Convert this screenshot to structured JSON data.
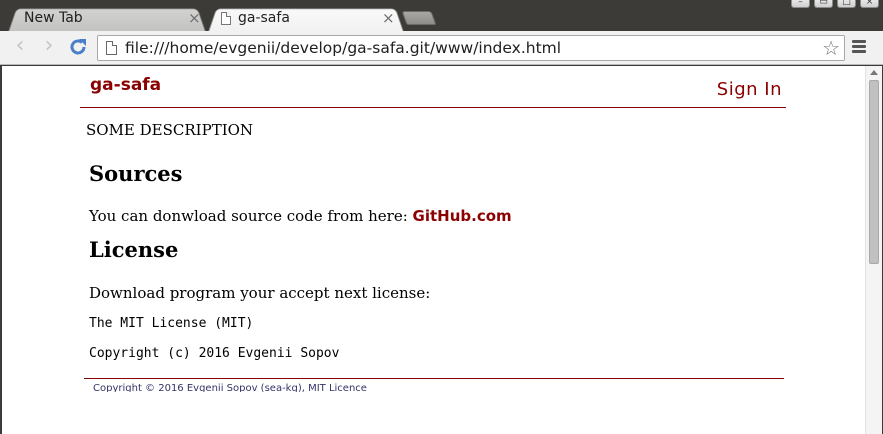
{
  "browser": {
    "tabs": [
      {
        "label": "New Tab",
        "active": false
      },
      {
        "label": "ga-safa",
        "active": true
      }
    ],
    "url": "file:///home/evgenii/develop/ga-safa.git/www/index.html"
  },
  "site": {
    "brand": "ga-safa",
    "sign_in": "Sign In",
    "description": "SOME DESCRIPTION",
    "sources_heading": "Sources",
    "sources_text": "You can donwload source code from here: ",
    "sources_link": "GitHub.com",
    "license_heading": "License",
    "license_text": "Download program your accept next license:",
    "license_name": "The MIT License (MIT)",
    "copyright": "Copyright (c) 2016 Evgenii Sopov",
    "footer": "Copyright © 2016 Evgenii Sopov (sea-kg), MIT Licence"
  },
  "colors": {
    "accent": "#8b0000",
    "chrome_dark": "#3c3b37"
  }
}
